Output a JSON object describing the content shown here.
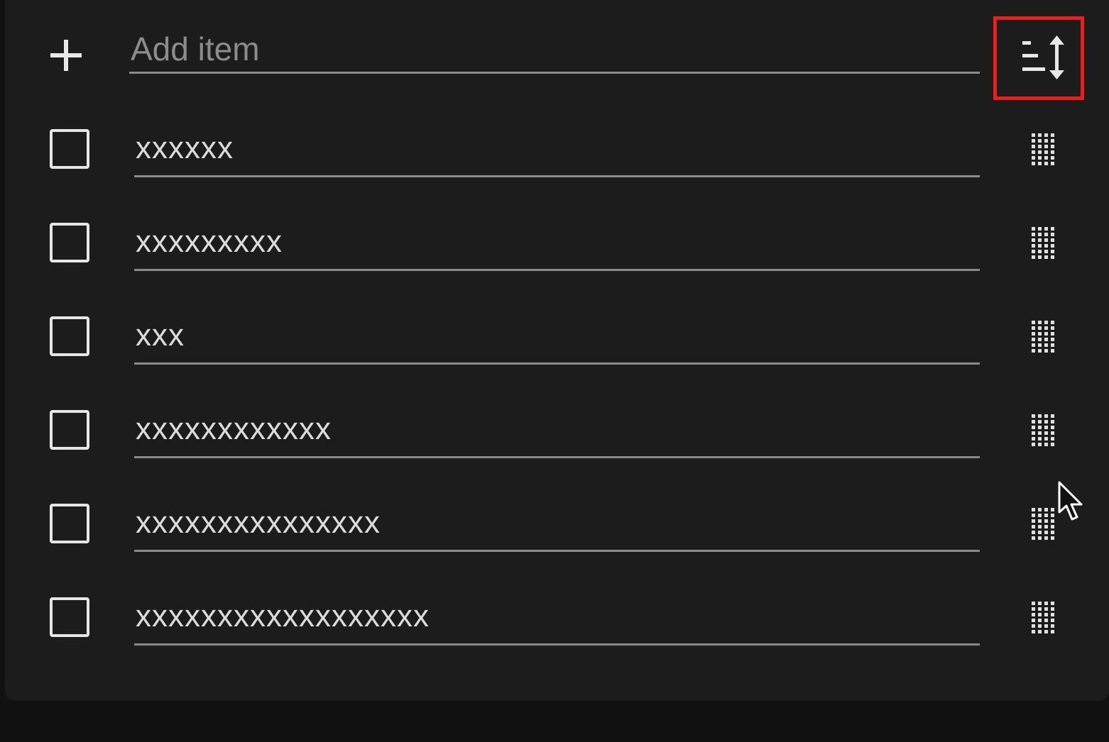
{
  "add_row": {
    "placeholder": "Add item",
    "plus_icon": "plus-icon",
    "sort_icon": "sort-icon"
  },
  "items": [
    {
      "text": "xxxxxx",
      "checked": false
    },
    {
      "text": "xxxxxxxxx",
      "checked": false
    },
    {
      "text": "xxx",
      "checked": false
    },
    {
      "text": "xxxxxxxxxxxx",
      "checked": false
    },
    {
      "text": "xxxxxxxxxxxxxxx",
      "checked": false
    },
    {
      "text": "xxxxxxxxxxxxxxxxxx",
      "checked": false
    }
  ],
  "icons": {
    "checkbox": "checkbox-unchecked-icon",
    "drag": "drag-handle-icon",
    "cursor": "mouse-pointer-icon"
  },
  "colors": {
    "background": "#111111",
    "card": "#1c1c1c",
    "highlight": "#ef1c1c",
    "text": "#dcdcdc",
    "underline": "#8a8a8a"
  }
}
